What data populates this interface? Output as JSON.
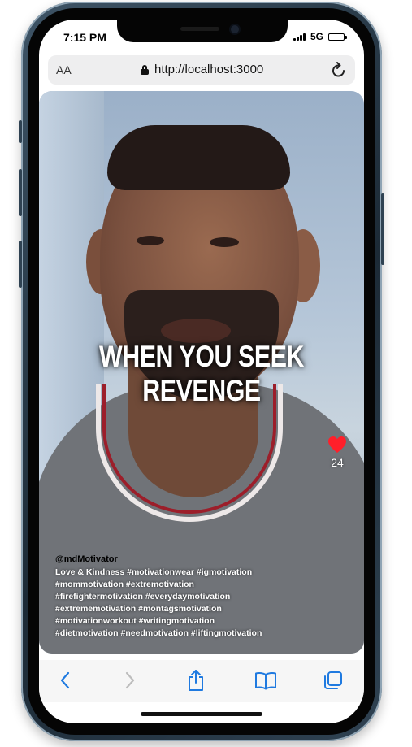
{
  "status_bar": {
    "time": "7:15 PM",
    "network": "5G"
  },
  "browser": {
    "text_size_label": "AA",
    "url": "http://localhost:3000"
  },
  "video": {
    "caption": "WHEN YOU SEEK REVENGE",
    "like_count": "24",
    "username": "@mdMotivator",
    "description_lines": [
      "Love & Kindness #motivationwear #igmotivation",
      "#mommotivation #extremotivation",
      "#firefightermotivation #everydaymotivation",
      "#extrememotivation #montagsmotivation",
      "#motivationworkout #writingmotivation",
      "#dietmotivation #needmotivation #liftingmotivation"
    ]
  },
  "toolbar": {
    "icons": [
      "chevron-left-icon",
      "chevron-right-icon",
      "share-icon",
      "book-icon",
      "tabs-icon"
    ]
  },
  "colors": {
    "accent": "#1f7ae0",
    "heart": "#ff1f2a",
    "frame": "#2f4252"
  }
}
